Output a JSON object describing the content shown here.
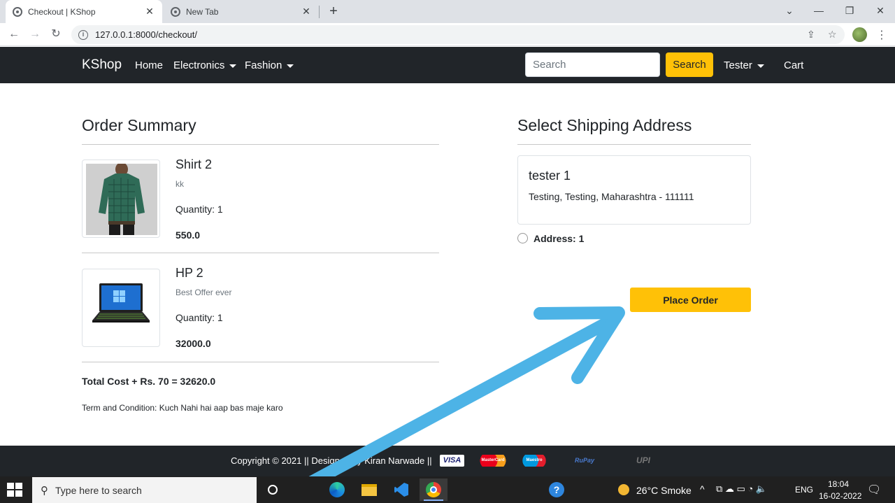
{
  "browser": {
    "tabs": [
      {
        "title": "Checkout | KShop",
        "active": true
      },
      {
        "title": "New Tab",
        "active": false
      }
    ],
    "url": "127.0.0.1:8000/checkout/"
  },
  "navbar": {
    "brand": "KShop",
    "links": {
      "home": "Home",
      "electronics": "Electronics",
      "fashion": "Fashion",
      "user": "Tester",
      "cart": "Cart"
    },
    "search_placeholder": "Search",
    "search_button": "Search"
  },
  "order_summary": {
    "title": "Order Summary",
    "items": [
      {
        "name": "Shirt 2",
        "description": "kk",
        "quantity": "Quantity: 1",
        "price": "550.0"
      },
      {
        "name": "HP 2",
        "description": "Best Offer ever",
        "quantity": "Quantity: 1",
        "price": "32000.0"
      }
    ],
    "total": "Total Cost + Rs. 70 = 32620.0",
    "terms": "Term and Condition: Kuch Nahi hai aap bas maje karo"
  },
  "shipping": {
    "title": "Select Shipping Address",
    "address_name": "tester 1",
    "address_line": "Testing, Testing, Maharashtra - 111111",
    "radio_label": "Address: 1",
    "place_order": "Place Order"
  },
  "footer": {
    "text": "Copyright © 2021 || Designed by Kiran Narwade ||",
    "payment_logos": [
      "VISA",
      "MasterCard",
      "Maestro",
      "RuPay",
      "UPI"
    ]
  },
  "annotation": {
    "color": "#4db3e6",
    "icon": "arrow-icon"
  },
  "taskbar": {
    "search_placeholder": "Type here to search",
    "weather": "26°C  Smoke",
    "lang": "ENG",
    "time": "18:04",
    "date": "16-02-2022"
  },
  "colors": {
    "accent": "#ffc107",
    "nav_bg": "#212529"
  }
}
